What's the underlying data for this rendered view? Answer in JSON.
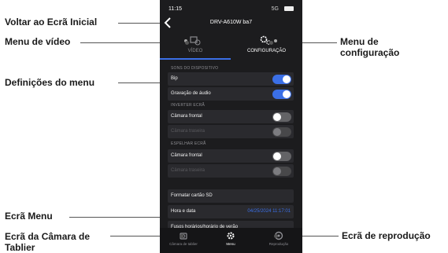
{
  "callouts": {
    "home": "Voltar ao Ecrã Inicial",
    "video_menu": "Menu de vídeo",
    "menu_settings": "Definições do menu",
    "menu_screen": "Ecrã Menu",
    "dashcam_screen": "Ecrã da Câmara de Tablier",
    "config_menu": "Menu de configuração",
    "playback_screen": "Ecrã de reprodução"
  },
  "status": {
    "time": "11:15",
    "network": "5G"
  },
  "header": {
    "device_title": "DRV-A610W ba7"
  },
  "tabs": [
    {
      "label": "VÍDEO",
      "active": false
    },
    {
      "label": "CONFIGURAÇÃO",
      "active": true
    }
  ],
  "sections": [
    {
      "title": "SONS DO DISPOSITIVO",
      "rows": [
        {
          "label": "Bip",
          "toggle": "on"
        },
        {
          "label": "Gravação de áudio",
          "toggle": "on"
        }
      ]
    },
    {
      "title": "INVERTER ECRÃ",
      "rows": [
        {
          "label": "Câmara frontal",
          "toggle": "off"
        },
        {
          "label": "Câmara traseira",
          "toggle": "disabled"
        }
      ]
    },
    {
      "title": "ESPELHAR ECRÃ",
      "rows": [
        {
          "label": "Câmara frontal",
          "toggle": "off"
        },
        {
          "label": "Câmara traseira",
          "toggle": "disabled"
        }
      ]
    }
  ],
  "actions": [
    {
      "label": "Formatar cartão SD",
      "value": ""
    },
    {
      "label": "Hora e data",
      "value": "04/25/2024 11:17:01"
    },
    {
      "label": "Fusos horários/horário de verão",
      "value": ""
    }
  ],
  "bottom_nav": [
    {
      "label": "Câmara de tablier",
      "active": false,
      "icon": "dashcam-icon"
    },
    {
      "label": "Menu",
      "active": true,
      "icon": "gear-icon"
    },
    {
      "label": "Reprodução",
      "active": false,
      "icon": "playback-icon"
    }
  ],
  "colors": {
    "accent": "#3b6fe6",
    "background": "#1c1c1e",
    "row": "#2a2a2e"
  }
}
